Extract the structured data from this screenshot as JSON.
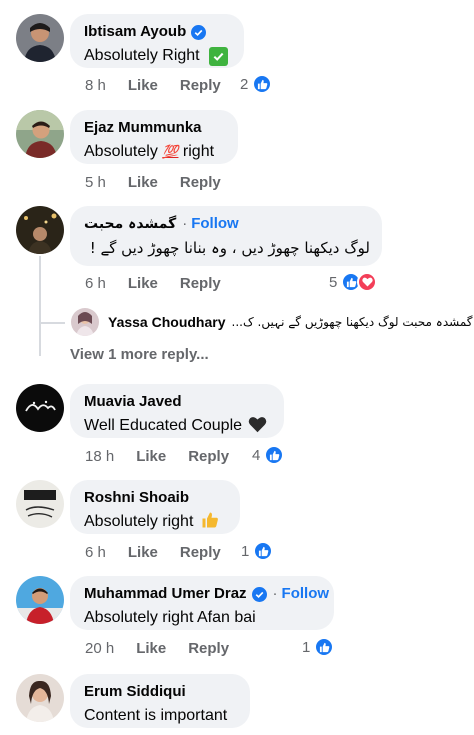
{
  "comments": [
    {
      "name": "Ibtisam Ayoub",
      "text": "Absolutely Right",
      "time": "8 h",
      "like": "Like",
      "reply": "Reply",
      "reactions": "2",
      "verified": true
    },
    {
      "name": "Ejaz Mummunka",
      "text_before": "Absolutely",
      "text_after": "right",
      "emoji": "💯",
      "time": "5 h",
      "like": "Like",
      "reply": "Reply"
    },
    {
      "name": "گمشدہ محبت",
      "follow": "Follow",
      "text": "لوگ دیکھنا چھوڑ دیں ، وہ بنانا چھوڑ دیں گے  !",
      "time": "6 h",
      "like": "Like",
      "reply": "Reply",
      "reactions": "5",
      "reply_preview": {
        "name": "Yassa Choudhary",
        "text": "گمشدہ محبت لوگ دیکھنا چھوڑیں گے نہیں. ک..."
      },
      "more_replies": "View 1 more reply..."
    },
    {
      "name": "Muavia Javed",
      "text": "Well Educated Couple",
      "time": "18 h",
      "like": "Like",
      "reply": "Reply",
      "reactions": "4"
    },
    {
      "name": "Roshni Shoaib",
      "text": "Absolutely right",
      "time": "6 h",
      "like": "Like",
      "reply": "Reply",
      "reactions": "1"
    },
    {
      "name": "Muhammad Umer Draz",
      "follow": "Follow",
      "text": "Absolutely right Afan bai",
      "time": "20 h",
      "like": "Like",
      "reply": "Reply",
      "reactions": "1",
      "verified": true
    },
    {
      "name": "Erum Siddiqui",
      "text": "Content is important"
    }
  ],
  "colors": {
    "like_blue": "#1877f2",
    "love_red": "#f33e58",
    "bubble": "#f0f2f5",
    "meta_gray": "#65676b"
  },
  "icons": [
    "verified-badge-icon",
    "check-mark-emoji",
    "hundred-points-emoji",
    "black-heart-emoji",
    "thumbs-up-emoji",
    "like-reaction-icon",
    "love-reaction-icon"
  ]
}
